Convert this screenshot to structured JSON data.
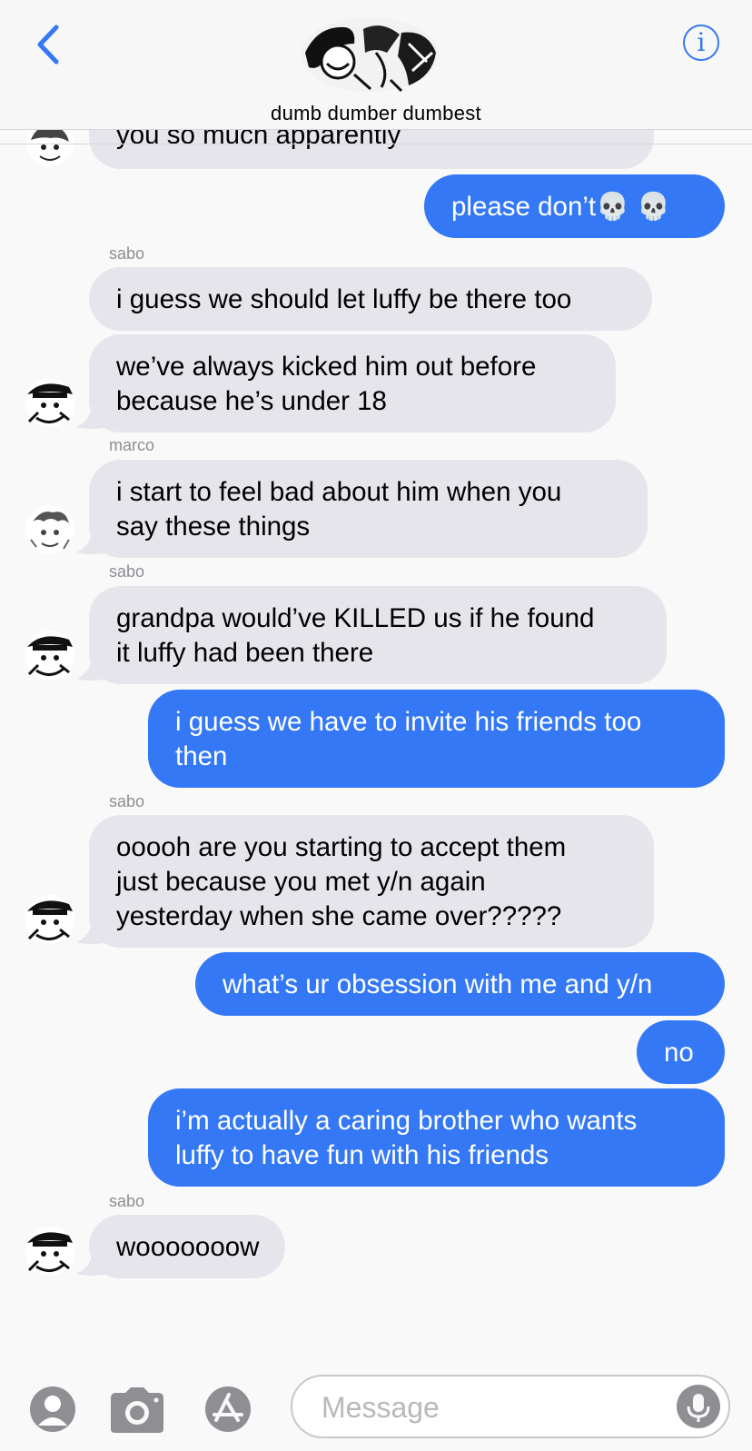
{
  "header": {
    "group_name": "dumb dumber dumbest",
    "info_glyph": "i"
  },
  "composer": {
    "placeholder": "Message"
  },
  "messages": {
    "m0": {
      "text": "you so much apparently"
    },
    "m1": {
      "text": "please don’t💀 💀"
    },
    "s1": "sabo",
    "m2": {
      "text": "i guess we should let luffy be there too"
    },
    "m3": {
      "line1": "we’ve always kicked him out before",
      "line2": "because he’s under 18"
    },
    "s2": "marco",
    "m4": {
      "line1": "i start to feel bad about him when you",
      "line2": "say these things"
    },
    "s3": "sabo",
    "m5": {
      "line1": "grandpa would’ve KILLED us if he found",
      "line2": "it luffy had been there"
    },
    "m6": {
      "line1": "i guess we have to invite his friends too",
      "line2": "then"
    },
    "s4": "sabo",
    "m7": {
      "line1": "ooooh are you starting to accept them",
      "line2": "just because you met y/n again",
      "line3": "yesterday when she came over?????"
    },
    "m8": {
      "text": "what’s ur obsession with me and y/n"
    },
    "m9": {
      "text": "no"
    },
    "m10": {
      "line1": "i’m actually a caring brother who wants",
      "line2": "luffy to have fun with his friends"
    },
    "s5": "sabo",
    "m11": {
      "text": "wooooooow"
    }
  },
  "colors": {
    "accent": "#3478f6",
    "incoming_bubble": "#e6e5eb",
    "sender_label": "#8e8e93"
  },
  "icons": [
    "back-chevron-icon",
    "info-icon",
    "group-avatar",
    "contact-icon",
    "camera-icon",
    "app-store-icon",
    "microphone-icon"
  ]
}
